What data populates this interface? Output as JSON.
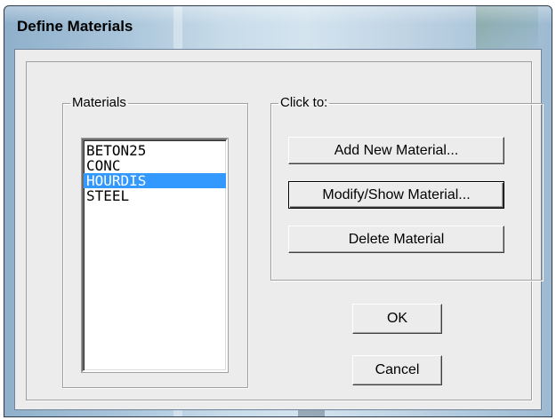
{
  "window": {
    "title": "Define Materials"
  },
  "materials": {
    "legend": "Materials",
    "items": [
      "BETON25",
      "CONC",
      "HOURDIS",
      "STEEL"
    ],
    "selected": "HOURDIS"
  },
  "actions": {
    "legend": "Click to:",
    "add_label": "Add New Material...",
    "modify_label": "Modify/Show Material...",
    "delete_label": "Delete Material"
  },
  "dialog": {
    "ok_label": "OK",
    "cancel_label": "Cancel"
  },
  "colors": {
    "selection": "#3399ff",
    "dialog_face": "#ececec"
  }
}
